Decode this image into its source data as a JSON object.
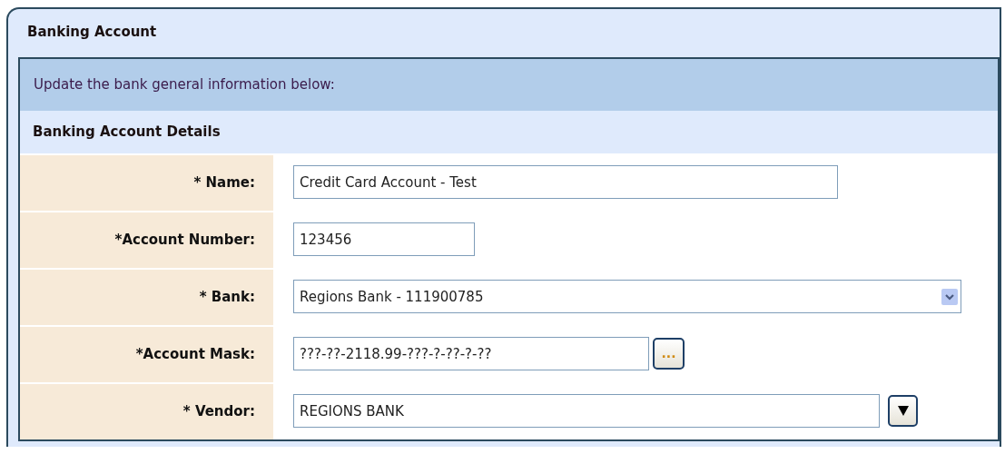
{
  "panel": {
    "title": "Banking Account"
  },
  "info": "Update the bank general information below:",
  "section": {
    "title": "Banking Account Details"
  },
  "fields": [
    {
      "kind": "text",
      "label": "* Name:",
      "value": "Credit Card Account - Test"
    },
    {
      "kind": "text",
      "label": "*Account Number:",
      "value": "123456"
    },
    {
      "kind": "select",
      "label": "* Bank:",
      "value": "Regions Bank - 111900785"
    },
    {
      "kind": "browse",
      "label": "*Account Mask:",
      "value": "???-??-2118.99-???-?-??-?-??",
      "button": "..."
    },
    {
      "kind": "lookup",
      "label": "* Vendor:",
      "value": "REGIONS BANK"
    }
  ]
}
